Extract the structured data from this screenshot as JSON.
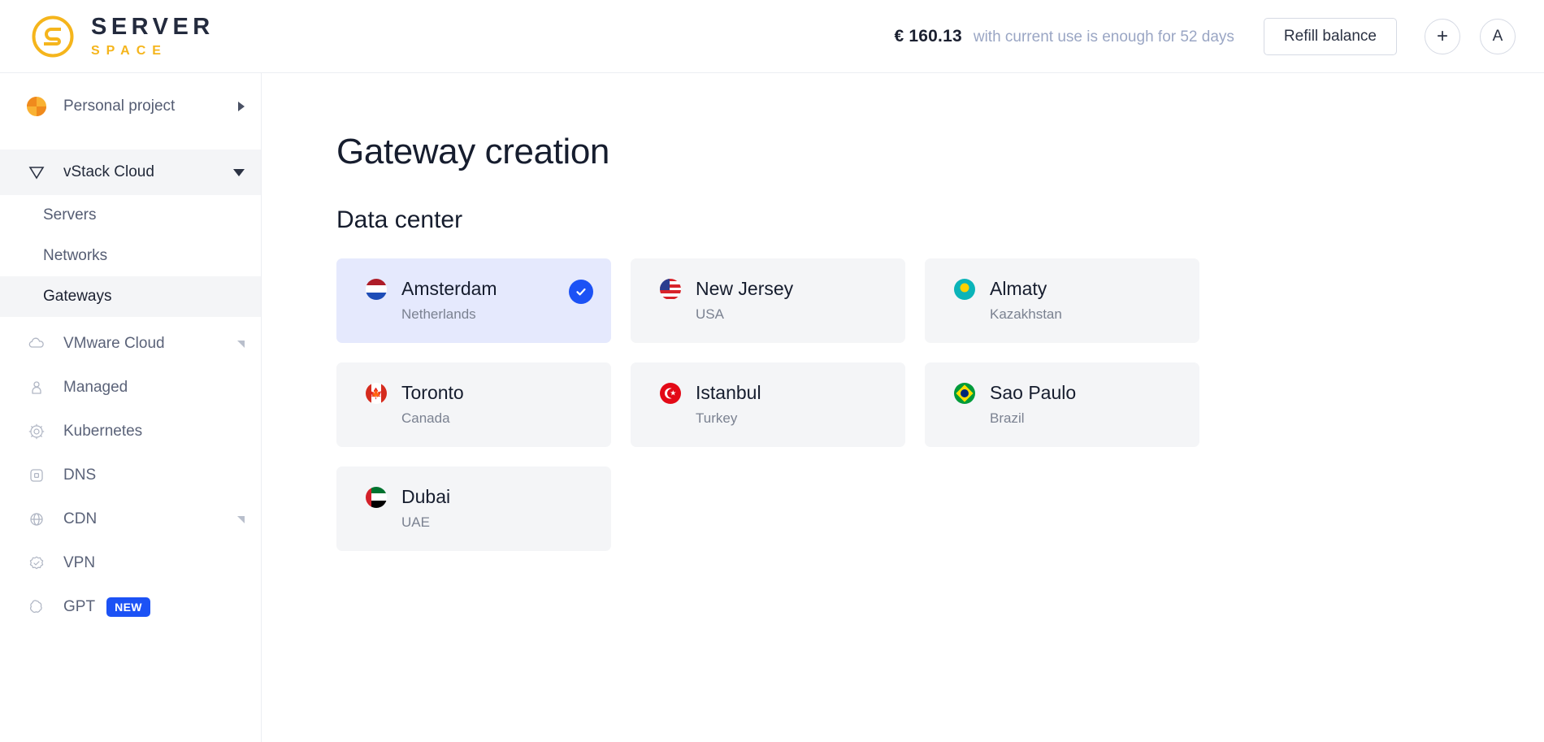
{
  "header": {
    "logo": {
      "primary": "SERVER",
      "secondary": "SPACE",
      "icon": "serverspace-s-logo-icon"
    },
    "balance_amount": "€ 160.13",
    "balance_note": "with current use is enough for 52 days",
    "refill_label": "Refill balance",
    "add_label": "+",
    "avatar_label": "A"
  },
  "sidebar": {
    "project": {
      "label": "Personal project",
      "icon": "project-avatar-icon",
      "expand_icon": "chevron-right-icon"
    },
    "groups": [
      {
        "label": "vStack Cloud",
        "icon": "vstack-nabla-icon",
        "active": true,
        "expanded": true,
        "expand_icon": "chevron-down-icon",
        "items": [
          {
            "label": "Servers",
            "active": false
          },
          {
            "label": "Networks",
            "active": false
          },
          {
            "label": "Gateways",
            "active": true
          }
        ]
      }
    ],
    "items": [
      {
        "label": "VMware Cloud",
        "icon": "cloud-icon",
        "expandable": true
      },
      {
        "label": "Managed",
        "icon": "person-shield-icon",
        "expandable": false
      },
      {
        "label": "Kubernetes",
        "icon": "kubernetes-helm-icon",
        "expandable": false
      },
      {
        "label": "DNS",
        "icon": "dns-square-icon",
        "expandable": false
      },
      {
        "label": "CDN",
        "icon": "globe-icon",
        "expandable": true
      },
      {
        "label": "VPN",
        "icon": "badge-check-icon",
        "expandable": false
      },
      {
        "label": "GPT",
        "icon": "gpt-knot-icon",
        "expandable": false,
        "badge": "NEW"
      }
    ]
  },
  "main": {
    "page_title": "Gateway creation",
    "section_title": "Data center",
    "selected_check_icon": "check-icon",
    "data_centers": [
      {
        "city": "Amsterdam",
        "country": "Netherlands",
        "flag": "f-nl",
        "flag_icon": "flag-netherlands-icon",
        "selected": true
      },
      {
        "city": "New Jersey",
        "country": "USA",
        "flag": "f-us",
        "flag_icon": "flag-usa-icon",
        "selected": false
      },
      {
        "city": "Almaty",
        "country": "Kazakhstan",
        "flag": "f-kz",
        "flag_icon": "flag-kazakhstan-icon",
        "selected": false
      },
      {
        "city": "Toronto",
        "country": "Canada",
        "flag": "f-ca",
        "flag_icon": "flag-canada-icon",
        "selected": false
      },
      {
        "city": "Istanbul",
        "country": "Turkey",
        "flag": "f-tr",
        "flag_icon": "flag-turkey-icon",
        "selected": false
      },
      {
        "city": "Sao Paulo",
        "country": "Brazil",
        "flag": "f-br",
        "flag_icon": "flag-brazil-icon",
        "selected": false
      },
      {
        "city": "Dubai",
        "country": "UAE",
        "flag": "f-ae",
        "flag_icon": "flag-uae-icon",
        "selected": false
      }
    ]
  },
  "colors": {
    "brand_yellow": "#f5b51c",
    "brand_navy": "#232a3d",
    "accent_blue": "#1c52f5",
    "selected_card_bg": "#e5e9fd",
    "card_bg": "#f4f5f7"
  }
}
